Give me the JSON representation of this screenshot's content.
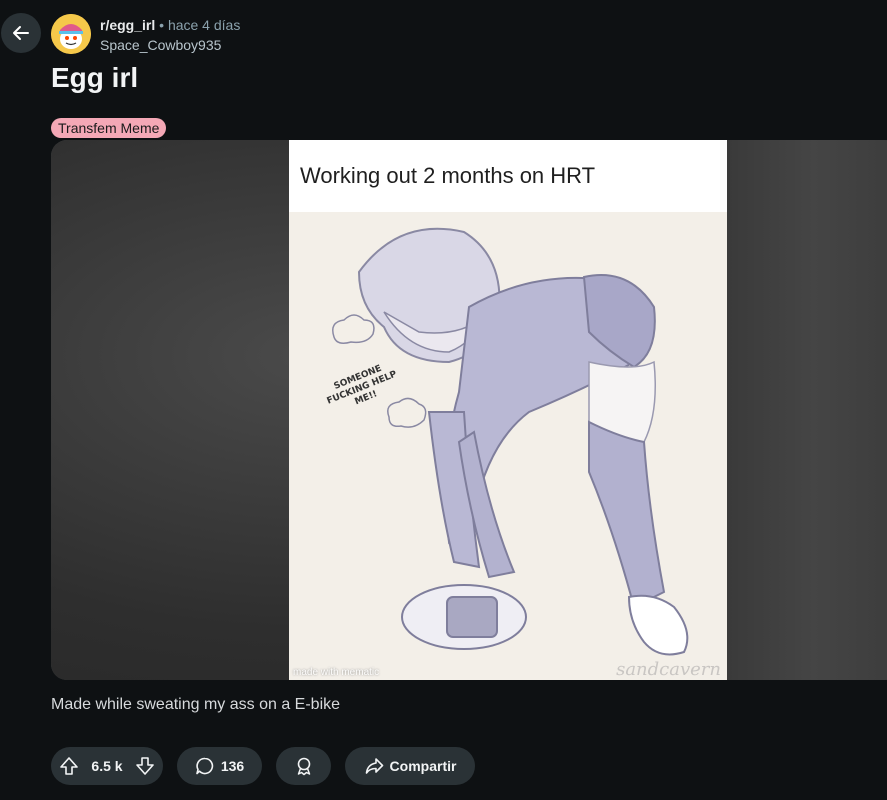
{
  "header": {
    "subreddit": "r/egg_irl",
    "separator": "•",
    "time_ago": "hace 4 días",
    "author": "Space_Cowboy935"
  },
  "post": {
    "title": "Egg irl",
    "flair": "Transfem Meme",
    "flair_color": "#f4a8b6",
    "body": "Made while sweating my ass on a E-bike"
  },
  "media": {
    "caption": "Working out 2 months on HRT",
    "speech_text": [
      "SOMEONE",
      "FUCKING HELP",
      "ME!!"
    ],
    "watermark": "made with mematic",
    "signature": "sandcavern"
  },
  "actions": {
    "vote_count": "6.5 k",
    "comment_count": "136",
    "share_label": "Compartir"
  },
  "icons": {
    "back": "back-arrow-icon",
    "upvote": "upvote-icon",
    "downvote": "downvote-icon",
    "comment": "comment-bubble-icon",
    "award": "award-icon",
    "share": "share-arrow-icon"
  },
  "colors": {
    "background": "#0e1113",
    "pill": "#2a3236",
    "muted_text": "#8ba2ad"
  }
}
